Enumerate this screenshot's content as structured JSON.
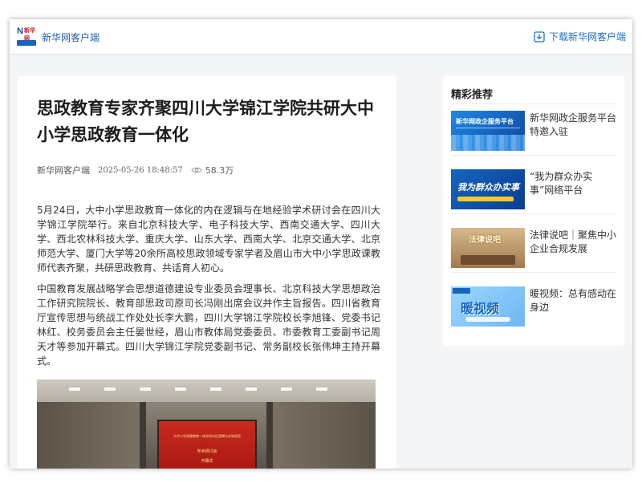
{
  "header": {
    "logo_text": "新华网",
    "brand": "新华网客户端",
    "download_label": "下载新华网客户端",
    "accent_color": "#1f6fc8"
  },
  "article": {
    "title": "思政教育专家齐聚四川大学锦江学院共研大中小学思政教育一体化",
    "source": "新华网客户端",
    "time": "2025-05-26 18:48:57",
    "views": "58.3万",
    "paragraphs": [
      "5月24日，大中小学思政教育一体化的内在逻辑与在地经验学术研讨会在四川大学锦江学院举行。来自北京科技大学、电子科技大学、西南交通大学、四川大学、西北农林科技大学、重庆大学、山东大学、西南大学、北京交通大学、北京师范大学、厦门大学等20余所高校思政领域专家学者及眉山市大中小学思政课教师代表齐聚，共研思政教育、共话育人初心。",
      "中国教育发展战略学会思想道德建设专业委员会理事长、北京科技大学思想政治工作研究院院长、教育部思政司原司长冯刚出席会议并作主旨报告。四川省教育厅宣传思想与统战工作处处长李大鹏，四川大学锦江学院校长李旭锋、党委书记林红、校务委员会主任晏世经，眉山市教体局党委委员、市委教育工委副书记周天才等参加开幕式。四川大学锦江学院党委副书记、常务副校长张伟坤主持开幕式。"
    ],
    "photo": {
      "screen_line1": "大中小学思政教育一体化的内在逻辑与在地经验",
      "screen_line2": "学术研讨会",
      "screen_line3": "开幕式"
    }
  },
  "sidebar": {
    "title": "精彩推荐",
    "items": [
      {
        "title": "新华网政企服务平台特邀入驻",
        "thumb_caption": "新华网政企服务平台"
      },
      {
        "title": "“我为群众办实事”网络平台",
        "thumb_caption": "我为群众办实事"
      },
      {
        "title": "法律说吧｜聚焦中小企业合规发展",
        "thumb_caption": "法律说吧"
      },
      {
        "title": "暖视频：总有感动在身边",
        "thumb_caption": "暖视频"
      }
    ]
  }
}
